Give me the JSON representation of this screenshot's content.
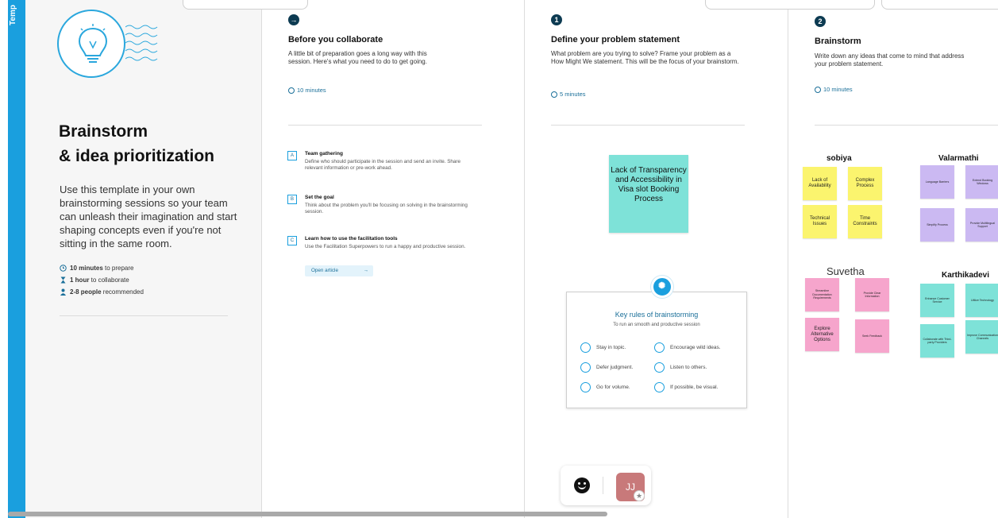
{
  "sidebar": {
    "label": "Temp"
  },
  "intro": {
    "title": "Brainstorm & idea prioritization",
    "title_line1": "Brainstorm",
    "title_line2": "& idea prioritization",
    "description": "Use this template in your own brainstorming sessions so your team can unleash their imagination and start shaping concepts even if you're not sitting in the same room.",
    "meta": [
      {
        "bold": "10 minutes",
        "rest": " to prepare",
        "icon": "clock-icon"
      },
      {
        "bold": "1 hour",
        "rest": " to collaborate",
        "icon": "hourglass-icon"
      },
      {
        "bold": "2-8 people",
        "rest": " recommended",
        "icon": "person-icon"
      }
    ]
  },
  "prep": {
    "badge": "→",
    "title": "Before you collaborate",
    "description": "A little bit of preparation goes a long way with this session. Here's what you need to do to get going.",
    "timer": "10 minutes",
    "items": [
      {
        "letter": "A",
        "title": "Team gathering",
        "desc": "Define who should participate in the session and send an invite. Share relevant information or pre-work ahead."
      },
      {
        "letter": "B",
        "title": "Set the goal",
        "desc": "Think about the problem you'll be focusing on solving in the brainstorming session."
      },
      {
        "letter": "C",
        "title": "Learn how to use the facilitation tools",
        "desc": "Use the Facilitation Superpowers to run a happy and productive session."
      }
    ],
    "open_article": "Open article"
  },
  "define": {
    "badge": "1",
    "title": "Define your problem statement",
    "description": "What problem are you trying to solve? Frame your problem as a How Might We statement. This will be the focus of your brainstorm.",
    "timer": "5 minutes",
    "problem": "Lack of Transparency and Accessibility in Visa slot Booking Process"
  },
  "rules": {
    "title": "Key rules of brainstorming",
    "subtitle": "To run an smooth and productive session",
    "items": [
      {
        "label": "Stay in topic.",
        "icon": "target-icon"
      },
      {
        "label": "Encourage wild ideas.",
        "icon": "lightbulb-icon"
      },
      {
        "label": "Defer judgment.",
        "icon": "pause-icon"
      },
      {
        "label": "Listen to others.",
        "icon": "ear-icon"
      },
      {
        "label": "Go for volume.",
        "icon": "stack-icon"
      },
      {
        "label": "If possible, be visual.",
        "icon": "eye-icon"
      }
    ]
  },
  "brainstorm": {
    "badge": "2",
    "title": "Brainstorm",
    "description": "Write down any ideas that come to mind that address your problem statement.",
    "timer": "10 minutes",
    "groups": [
      {
        "owner": "sobiya",
        "color": "yellow",
        "notes": [
          "Lack of Availability",
          "Complex Process",
          "Technical Issues",
          "Time Constraints"
        ]
      },
      {
        "owner": "Valarmathi",
        "color": "purple",
        "notes": [
          "Language Barriers",
          "Extend Booking Windows",
          "Simplify Process",
          "Provide Multilingual Support"
        ]
      },
      {
        "owner": "Suvetha",
        "color": "pink",
        "notes": [
          "Streamline Documentation Requirements",
          "Provide Clear Information",
          "Explore Alternative Options",
          "Seek Feedback"
        ]
      },
      {
        "owner": "Karthikadevi",
        "color": "teal",
        "notes": [
          "Enhance Customer Service",
          "Utilize Technology",
          "Collaborate with Third-party Providers",
          "Improve Communication Channels"
        ]
      }
    ]
  },
  "toolbar": {
    "avatar_initials": "JJ"
  },
  "colors": {
    "accent": "#1a9fde",
    "dark_badge": "#0d3b52"
  }
}
